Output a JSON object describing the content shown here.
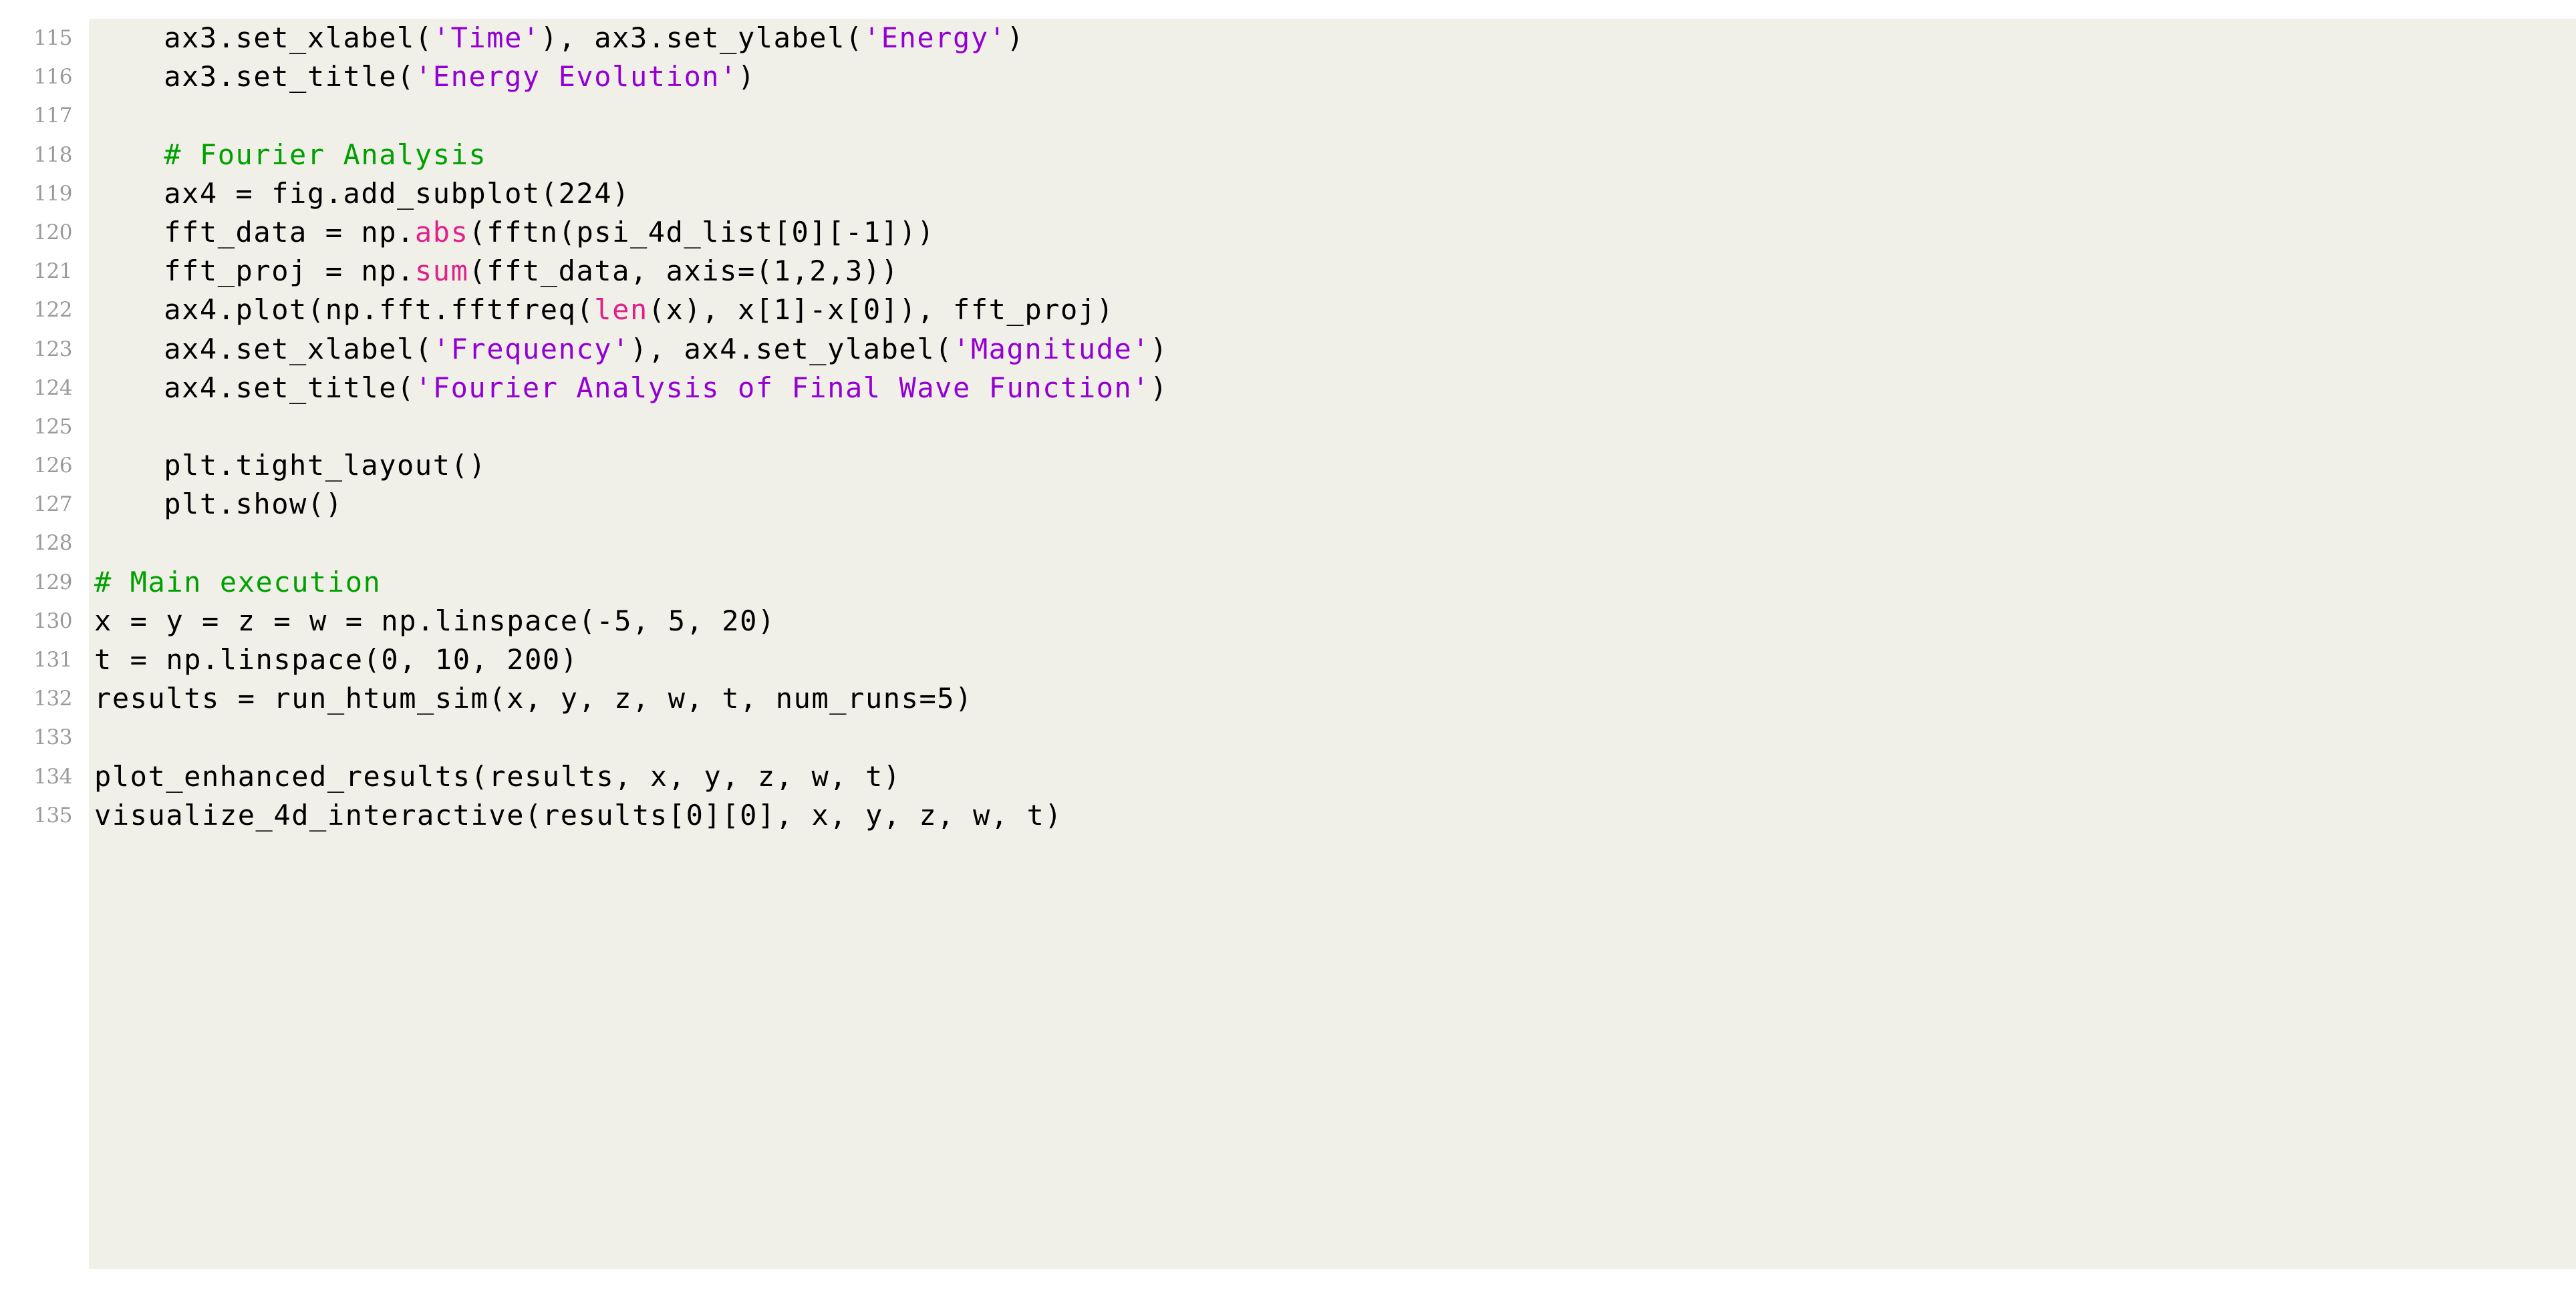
{
  "listing": {
    "language": "Python",
    "background_color": "#f1f0e8",
    "page_background": "#ffffff",
    "lineno_color": "#9a9a9a",
    "colors": {
      "comment": "#00a000",
      "string": "#9400d3",
      "builtin": "#e0218a",
      "default": "#000000"
    },
    "first_line_number": 115,
    "last_line_number": 135,
    "lines": [
      {
        "number": "115",
        "indent": 4,
        "tokens": [
          {
            "t": "ax3.set_xlabel(",
            "c": "def"
          },
          {
            "t": "'Time'",
            "c": "str"
          },
          {
            "t": "), ax3.set_ylabel(",
            "c": "def"
          },
          {
            "t": "'Energy'",
            "c": "str"
          },
          {
            "t": ")",
            "c": "def"
          }
        ]
      },
      {
        "number": "116",
        "indent": 4,
        "tokens": [
          {
            "t": "ax3.set_title(",
            "c": "def"
          },
          {
            "t": "'Energy Evolution'",
            "c": "str"
          },
          {
            "t": ")",
            "c": "def"
          }
        ]
      },
      {
        "number": "117",
        "indent": 0,
        "tokens": []
      },
      {
        "number": "118",
        "indent": 4,
        "tokens": [
          {
            "t": "# Fourier Analysis",
            "c": "com"
          }
        ]
      },
      {
        "number": "119",
        "indent": 4,
        "tokens": [
          {
            "t": "ax4 = fig.add_subplot(224)",
            "c": "def"
          }
        ]
      },
      {
        "number": "120",
        "indent": 4,
        "tokens": [
          {
            "t": "fft_data = np.",
            "c": "def"
          },
          {
            "t": "abs",
            "c": "bif"
          },
          {
            "t": "(fftn(psi_4d_list[0][-1]))",
            "c": "def"
          }
        ]
      },
      {
        "number": "121",
        "indent": 4,
        "tokens": [
          {
            "t": "fft_proj = np.",
            "c": "def"
          },
          {
            "t": "sum",
            "c": "bif"
          },
          {
            "t": "(fft_data, axis=(1,2,3))",
            "c": "def"
          }
        ]
      },
      {
        "number": "122",
        "indent": 4,
        "tokens": [
          {
            "t": "ax4.plot(np.fft.fftfreq(",
            "c": "def"
          },
          {
            "t": "len",
            "c": "bif"
          },
          {
            "t": "(x), x[1]-x[0]), fft_proj)",
            "c": "def"
          }
        ]
      },
      {
        "number": "123",
        "indent": 4,
        "tokens": [
          {
            "t": "ax4.set_xlabel(",
            "c": "def"
          },
          {
            "t": "'Frequency'",
            "c": "str"
          },
          {
            "t": "), ax4.set_ylabel(",
            "c": "def"
          },
          {
            "t": "'Magnitude'",
            "c": "str"
          },
          {
            "t": ")",
            "c": "def"
          }
        ]
      },
      {
        "number": "124",
        "indent": 4,
        "tokens": [
          {
            "t": "ax4.set_title(",
            "c": "def"
          },
          {
            "t": "'Fourier Analysis of Final Wave Function'",
            "c": "str"
          },
          {
            "t": ")",
            "c": "def"
          }
        ]
      },
      {
        "number": "125",
        "indent": 0,
        "tokens": []
      },
      {
        "number": "126",
        "indent": 4,
        "tokens": [
          {
            "t": "plt.tight_layout()",
            "c": "def"
          }
        ]
      },
      {
        "number": "127",
        "indent": 4,
        "tokens": [
          {
            "t": "plt.show()",
            "c": "def"
          }
        ]
      },
      {
        "number": "128",
        "indent": 0,
        "tokens": []
      },
      {
        "number": "129",
        "indent": 0,
        "tokens": [
          {
            "t": "# Main execution",
            "c": "com"
          }
        ]
      },
      {
        "number": "130",
        "indent": 0,
        "tokens": [
          {
            "t": "x = y = z = w = np.linspace(-5, 5, 20)",
            "c": "def"
          }
        ]
      },
      {
        "number": "131",
        "indent": 0,
        "tokens": [
          {
            "t": "t = np.linspace(0, 10, 200)",
            "c": "def"
          }
        ]
      },
      {
        "number": "132",
        "indent": 0,
        "tokens": [
          {
            "t": "results = run_htum_sim(x, y, z, w, t, num_runs=5)",
            "c": "def"
          }
        ]
      },
      {
        "number": "133",
        "indent": 0,
        "tokens": []
      },
      {
        "number": "134",
        "indent": 0,
        "tokens": [
          {
            "t": "plot_enhanced_results(results, x, y, z, w, t)",
            "c": "def"
          }
        ]
      },
      {
        "number": "135",
        "indent": 0,
        "tokens": [
          {
            "t": "visualize_4d_interactive(results[0][0], x, y, z, w, t)",
            "c": "def"
          }
        ]
      }
    ]
  }
}
